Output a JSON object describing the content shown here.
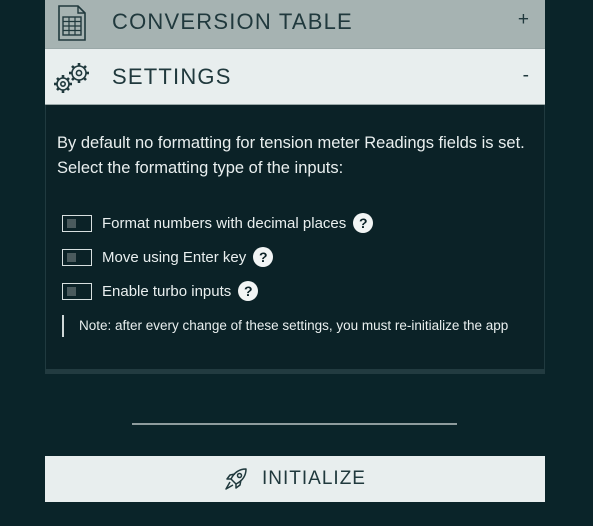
{
  "conversion_table": {
    "title": "CONVERSION TABLE",
    "toggle": "+",
    "icon": "spreadsheet-icon"
  },
  "settings": {
    "title": "SETTINGS",
    "toggle": "-",
    "icon": "gears-icon",
    "intro": "By default no formatting for tension meter Readings fields is set. Select the formatting type of the inputs:",
    "options": [
      {
        "label": "Format numbers with decimal places",
        "checked": false,
        "help": "?"
      },
      {
        "label": "Move using Enter key",
        "checked": false,
        "help": "?"
      },
      {
        "label": "Enable turbo inputs",
        "checked": false,
        "help": "?"
      }
    ],
    "note": "Note: after every change of these settings, you must re-initialize the app"
  },
  "initialize": {
    "label": "INITIALIZE",
    "icon": "rocket-icon"
  },
  "colors": {
    "background": "#0a2429",
    "header_active": "#e8eeee",
    "header_inactive": "#a6b3b2",
    "text_light": "#e9efef",
    "text_dark": "#20393d"
  }
}
